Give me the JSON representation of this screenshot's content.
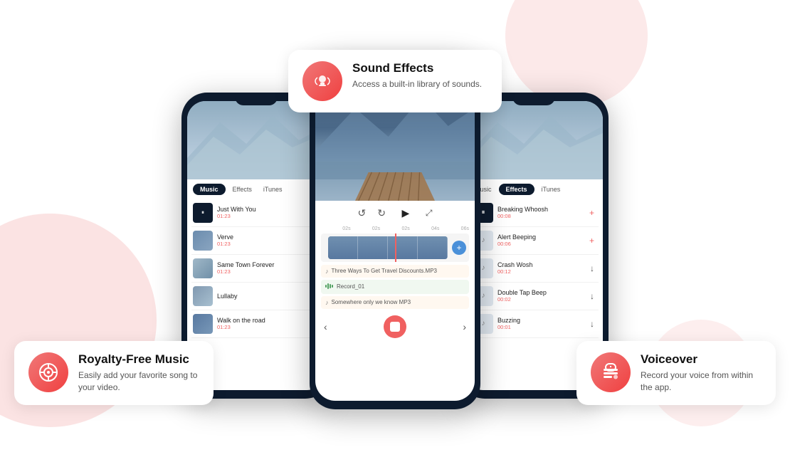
{
  "page": {
    "bg_color": "#ffffff"
  },
  "left_phone": {
    "tabs": [
      "Music",
      "Effects",
      "iTunes"
    ],
    "active_tab": "Music",
    "songs": [
      {
        "title": "Just With You",
        "duration": "01:23",
        "action": "pause",
        "has_thumb": true
      },
      {
        "title": "Verve",
        "duration": "01:23",
        "action": "add",
        "has_thumb": true
      },
      {
        "title": "Same Town Forever",
        "duration": "01:23",
        "action": "spin",
        "has_thumb": true
      },
      {
        "title": "Lullaby",
        "duration": "",
        "action": "download",
        "has_thumb": true
      },
      {
        "title": "Walk on the road",
        "duration": "01:23",
        "action": "download",
        "has_thumb": true
      }
    ]
  },
  "center_phone": {
    "timeline_marks": [
      "",
      "02s",
      "02s",
      "02s",
      "04s",
      "06s"
    ],
    "audio_tracks": [
      {
        "label": "Three Ways To Get Travel Discounts.MP3",
        "type": "music"
      },
      {
        "label": "Record_01",
        "type": "record"
      },
      {
        "label": "Somewhere only we know MP3",
        "type": "music"
      }
    ]
  },
  "right_phone": {
    "tabs": [
      "Music",
      "Effects",
      "iTunes"
    ],
    "active_tab": "Effects",
    "effects": [
      {
        "title": "Breaking Whoosh",
        "duration": "00:08",
        "action": "pause"
      },
      {
        "title": "Alert Beeping",
        "duration": "00:06",
        "action": "add"
      },
      {
        "title": "Crash Wosh",
        "duration": "00:12",
        "action": "download"
      },
      {
        "title": "Double Tap Beep",
        "duration": "00:02",
        "action": "download"
      },
      {
        "title": "Buzzing",
        "duration": "00:01",
        "action": "download"
      }
    ]
  },
  "feature_cards": {
    "left": {
      "icon": "🎵",
      "title": "Royalty-Free Music",
      "desc": "Easily add your favorite song to your video."
    },
    "center": {
      "icon": "🎤",
      "title": "Sound Effects",
      "desc": "Access a built-in library of sounds."
    },
    "right": {
      "icon": "🎙",
      "title": "Voiceover",
      "desc": "Record your voice from within the app."
    }
  }
}
